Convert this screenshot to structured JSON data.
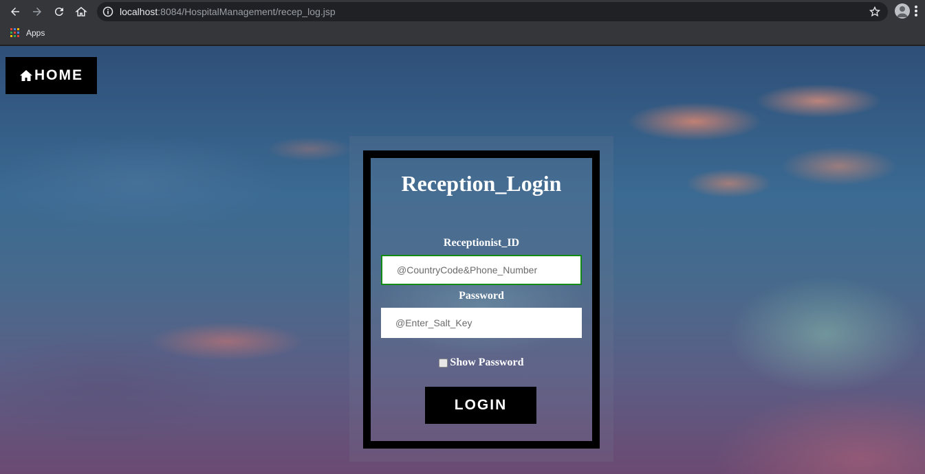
{
  "browser": {
    "url_host": "localhost",
    "url_rest": ":8084/HospitalManagement/recep_log.jsp",
    "bookmarks": {
      "apps_label": "Apps"
    }
  },
  "page": {
    "home_button_label": "HOME",
    "title": "Reception_Login",
    "receptionist_id": {
      "label": "Receptionist_ID",
      "placeholder": "@CountryCode&Phone_Number",
      "value": ""
    },
    "password": {
      "label": "Password",
      "placeholder": "@Enter_Salt_Key",
      "value": ""
    },
    "show_password": {
      "label": "Show Password",
      "checked": false
    },
    "login_button_label": "LOGIN"
  },
  "colors": {
    "accent_border": "#138a13",
    "button_bg": "#000000",
    "text": "#ffffff"
  }
}
